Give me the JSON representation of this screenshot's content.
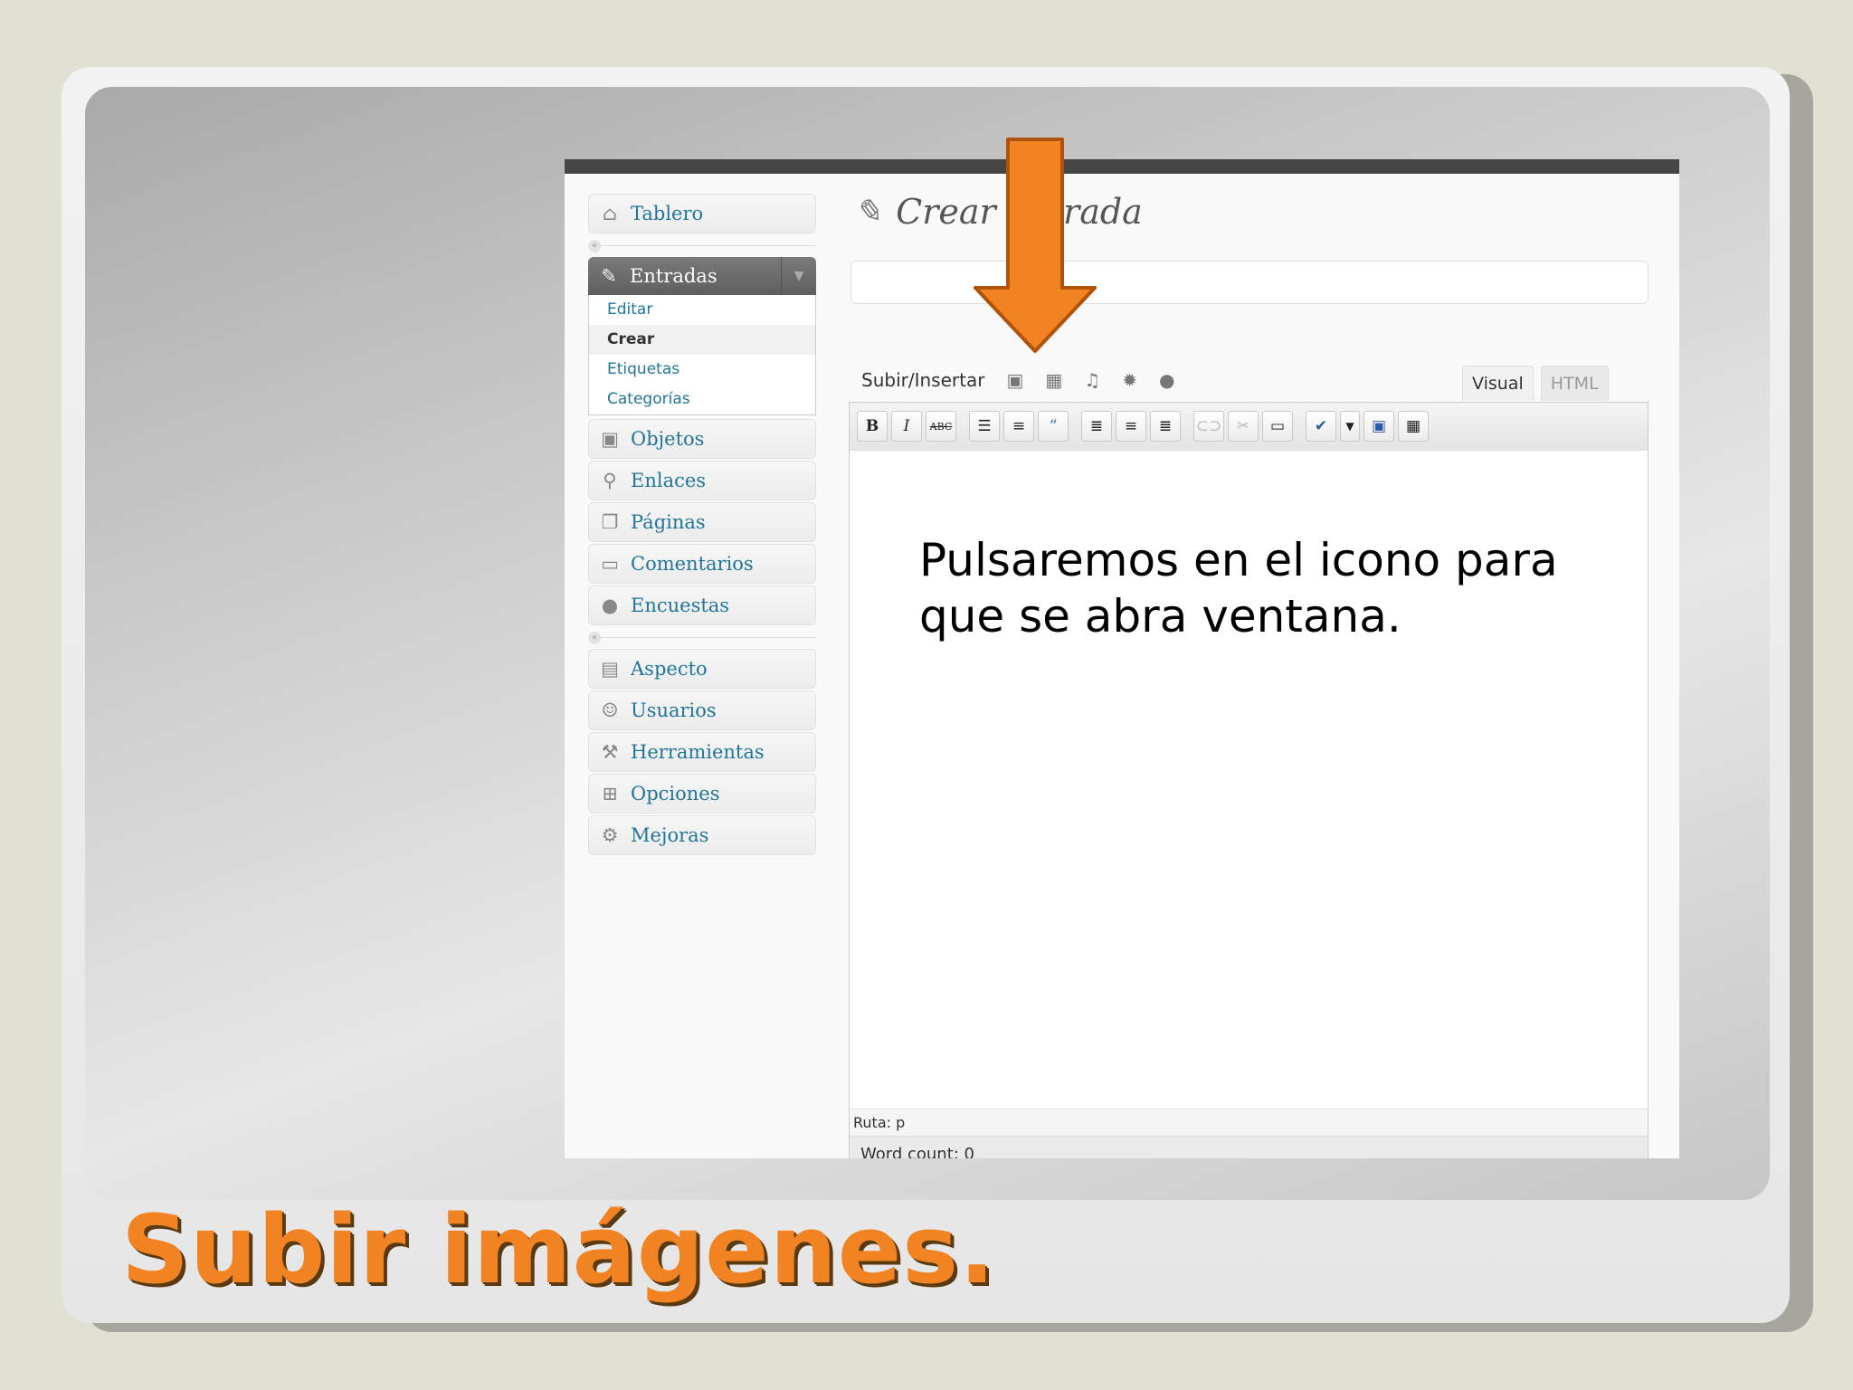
{
  "slide": {
    "title": "Subir imágenes."
  },
  "sidebar": {
    "dashboard": {
      "label": "Tablero",
      "icon": "home-icon"
    },
    "posts": {
      "label": "Entradas",
      "icon": "pin-icon",
      "submenu": [
        "Editar",
        "Crear",
        "Etiquetas",
        "Categorías"
      ],
      "current": "Crear"
    },
    "items": [
      {
        "label": "Objetos",
        "icon": "media-icon"
      },
      {
        "label": "Enlaces",
        "icon": "link-icon"
      },
      {
        "label": "Páginas",
        "icon": "pages-icon"
      },
      {
        "label": "Comentarios",
        "icon": "comment-icon"
      },
      {
        "label": "Encuestas",
        "icon": "poll-icon"
      }
    ],
    "items2": [
      {
        "label": "Aspecto",
        "icon": "appearance-icon"
      },
      {
        "label": "Usuarios",
        "icon": "users-icon"
      },
      {
        "label": "Herramientas",
        "icon": "tools-icon"
      },
      {
        "label": "Opciones",
        "icon": "settings-icon"
      },
      {
        "label": "Mejoras",
        "icon": "plugins-icon"
      }
    ]
  },
  "page": {
    "title": "Crear entrada"
  },
  "media": {
    "label": "Subir/Insertar"
  },
  "editor": {
    "tabs": [
      "Visual",
      "HTML"
    ],
    "active_tab": "Visual",
    "path": "Ruta: p",
    "word_count": "Word count: 0"
  },
  "annotation": {
    "text": "Pulsaremos en el icono para que se abra ventana."
  },
  "colors": {
    "accent": "#f28322",
    "link": "#21759b"
  }
}
